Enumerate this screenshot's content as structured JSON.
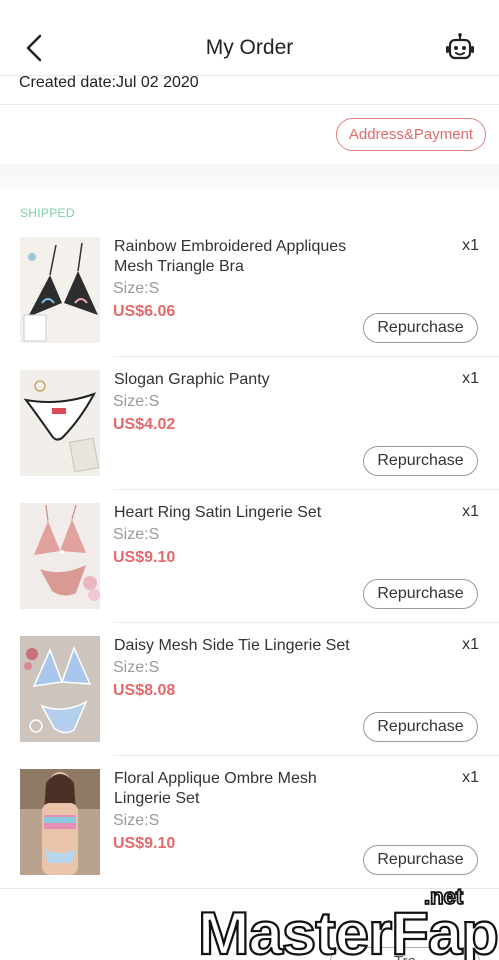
{
  "header": {
    "title": "My Order"
  },
  "order": {
    "created_date": "Created date:Jul 02 2020",
    "address_payment_label": "Address&Payment",
    "status": "SHIPPED"
  },
  "items": [
    {
      "name": "Rainbow Embroidered Appliques Mesh Triangle Bra",
      "size": "Size:S",
      "price": "US$6.06",
      "qty": "x1",
      "repurchase_label": "Repurchase"
    },
    {
      "name": "Slogan Graphic Panty",
      "size": "Size:S",
      "price": "US$4.02",
      "qty": "x1",
      "repurchase_label": "Repurchase"
    },
    {
      "name": "Heart Ring Satin Lingerie Set",
      "size": "Size:S",
      "price": "US$9.10",
      "qty": "x1",
      "repurchase_label": "Repurchase"
    },
    {
      "name": "Daisy Mesh Side Tie Lingerie Set",
      "size": "Size:S",
      "price": "US$8.08",
      "qty": "x1",
      "repurchase_label": "Repurchase"
    },
    {
      "name": "Floral Applique Ombre Mesh Lingerie Set",
      "size": "Size:S",
      "price": "US$9.10",
      "qty": "x1",
      "repurchase_label": "Repurchase"
    }
  ],
  "bottom": {
    "track_label": "Tra"
  },
  "watermark": {
    "text": "MasterFap",
    "suffix": ".net"
  },
  "colors": {
    "accent": "#e5686a",
    "status": "#7fd0a7",
    "border": "#ececec"
  },
  "icons": {
    "back": "chevron-left-icon",
    "support": "robot-icon"
  }
}
